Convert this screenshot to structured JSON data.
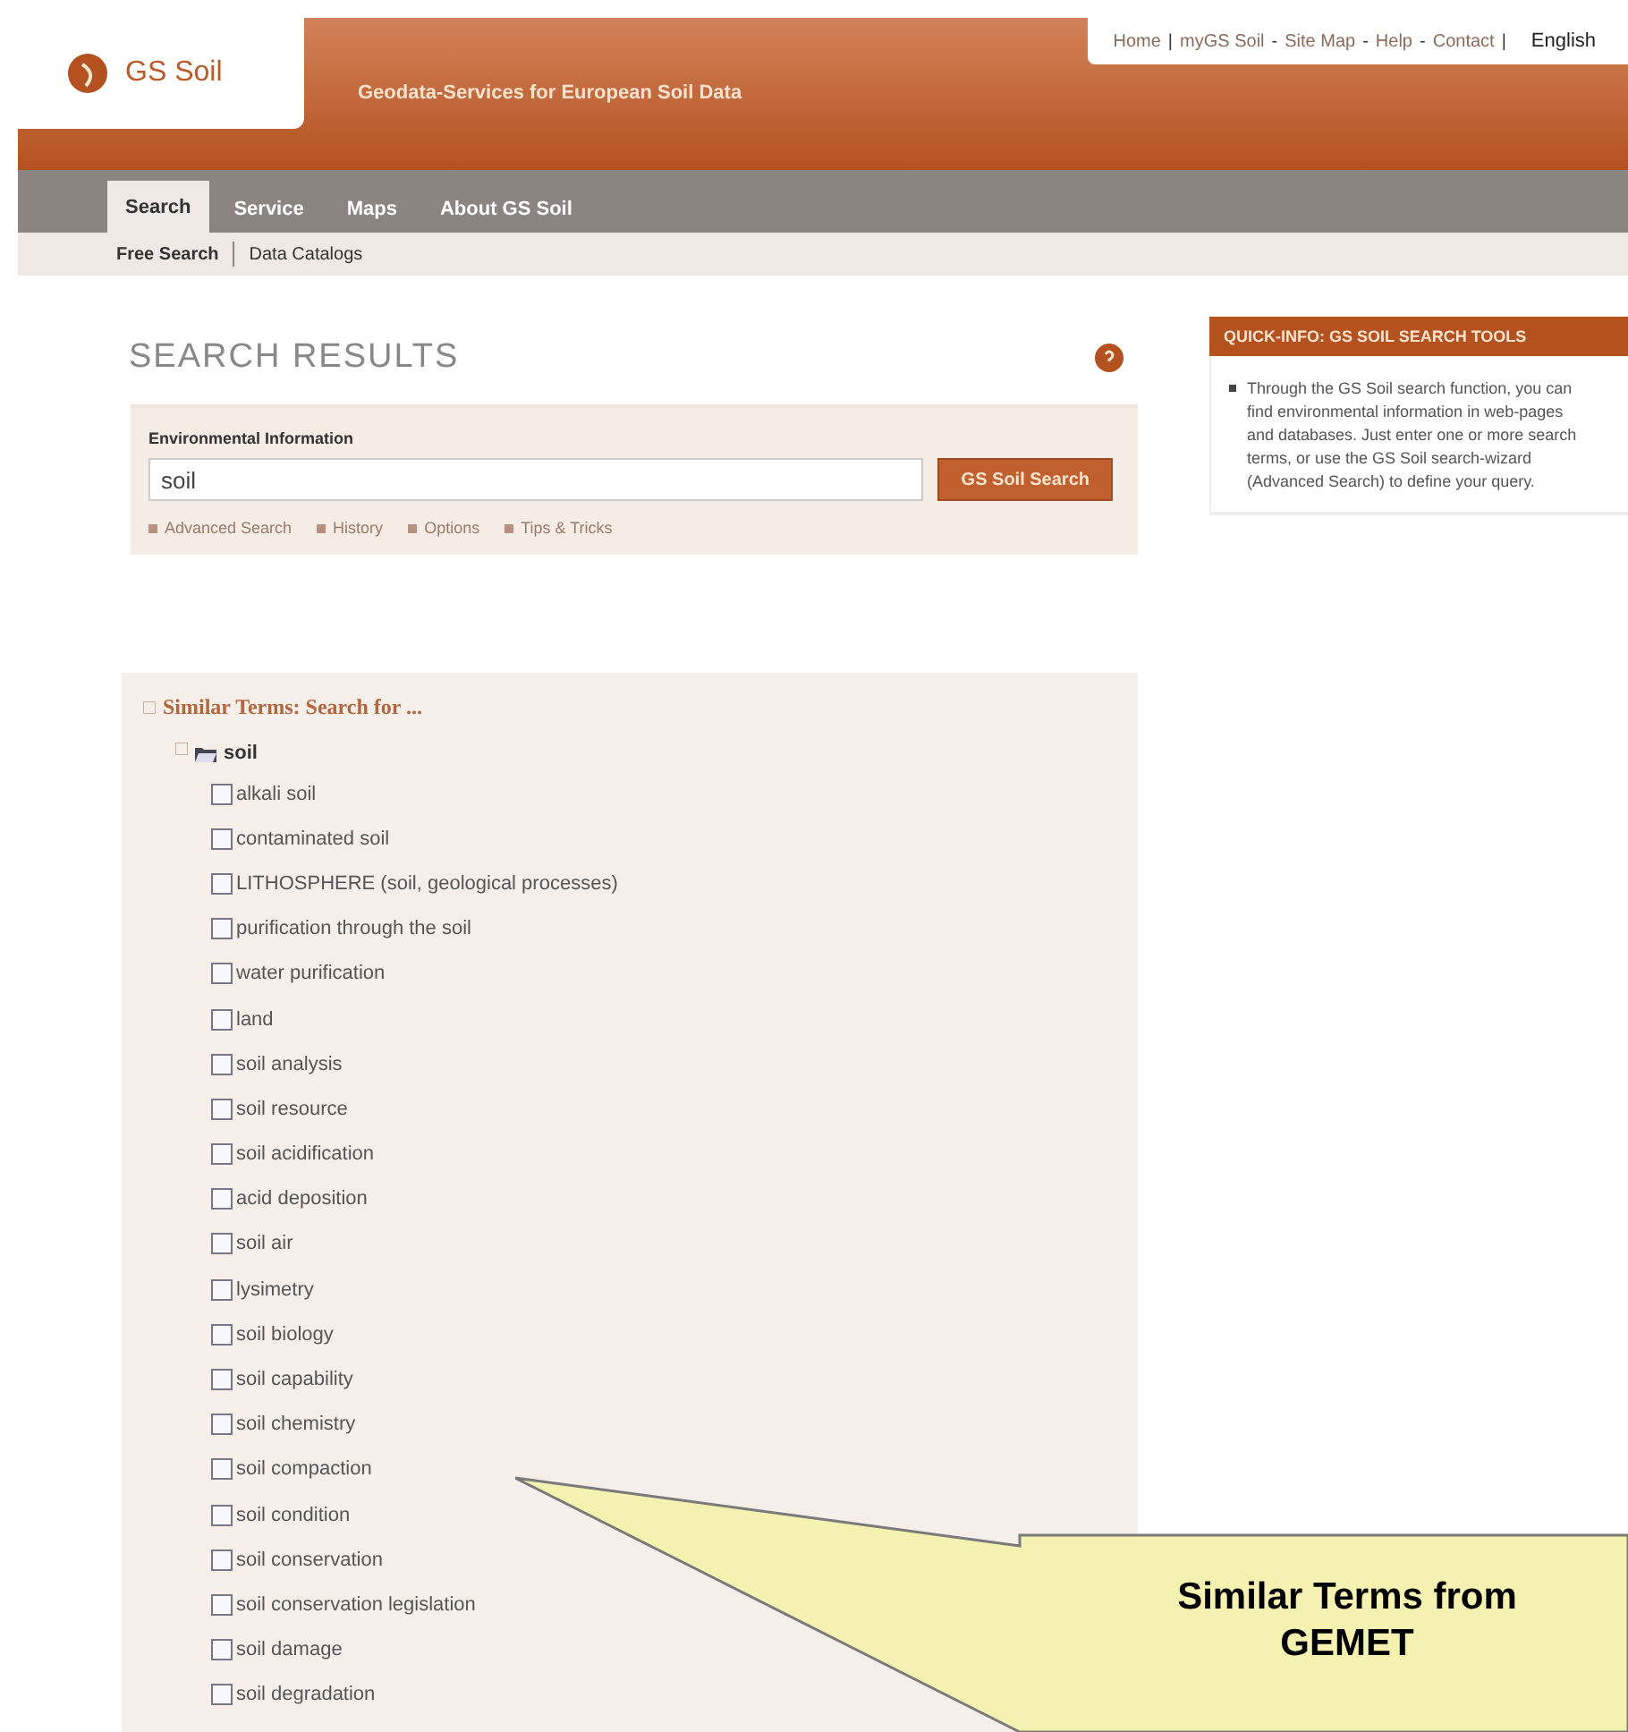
{
  "header": {
    "logo": "GS Soil",
    "tagline": "Geodata-Services for European Soil Data",
    "top_links": [
      {
        "kind": "link",
        "text": "Home"
      },
      {
        "kind": "separator",
        "text": "|"
      },
      {
        "kind": "link",
        "text": "myGS Soil"
      },
      {
        "kind": "separator",
        "text": "-"
      },
      {
        "kind": "link",
        "text": "Site Map"
      },
      {
        "kind": "separator",
        "text": "-"
      },
      {
        "kind": "link",
        "text": "Help"
      },
      {
        "kind": "separator",
        "text": "-"
      },
      {
        "kind": "link",
        "text": "Contact"
      },
      {
        "kind": "separator",
        "text": "|"
      }
    ],
    "language": "English"
  },
  "tabs": [
    {
      "label": "Search",
      "selected": true
    },
    {
      "label": "Service",
      "selected": false
    },
    {
      "label": "Maps",
      "selected": false
    },
    {
      "label": "About GS Soil",
      "selected": false
    }
  ],
  "subnav": [
    {
      "label": "Free Search",
      "selected": true
    },
    {
      "label": "Data Catalogs",
      "selected": false
    }
  ],
  "page_title": "SEARCH RESULTS",
  "search": {
    "label": "Environmental Information",
    "value": "soil",
    "button": "GS Soil Search",
    "links": [
      "Advanced Search",
      "History",
      "Options",
      "Tips & Tricks"
    ]
  },
  "similar_terms": {
    "title": "Similar Terms: Search for ...",
    "root": {
      "label": "soil",
      "expanded": true,
      "children": [
        {
          "label": "alkali soil",
          "checked": false
        },
        {
          "label": "contaminated soil",
          "checked": false
        },
        {
          "label": "LITHOSPHERE (soil, geological processes)",
          "checked": false
        },
        {
          "label": "purification through the soil",
          "checked": false
        },
        {
          "label": "water purification",
          "checked": false
        },
        {
          "label": "land",
          "checked": false
        },
        {
          "label": "soil analysis",
          "checked": false
        },
        {
          "label": "soil resource",
          "checked": false
        },
        {
          "label": "soil acidification",
          "checked": false
        },
        {
          "label": "acid deposition",
          "checked": false
        },
        {
          "label": "soil air",
          "checked": false
        },
        {
          "label": "lysimetry",
          "checked": false
        },
        {
          "label": "soil biology",
          "checked": false
        },
        {
          "label": "soil capability",
          "checked": false
        },
        {
          "label": "soil chemistry",
          "checked": false
        },
        {
          "label": "soil compaction",
          "checked": false
        },
        {
          "label": "soil condition",
          "checked": false
        },
        {
          "label": "soil conservation",
          "checked": false
        },
        {
          "label": "soil conservation legislation",
          "checked": false
        },
        {
          "label": "soil damage",
          "checked": false
        },
        {
          "label": "soil degradation",
          "checked": false
        }
      ]
    }
  },
  "quick_info": {
    "title": "QUICK-INFO: GS SOIL SEARCH TOOLS",
    "text": "Through the GS Soil search function, you can find environmental information in web-pages and databases. Just enter one or more search terms, or use the GS Soil search-wizard (Advanced Search) to define your query."
  },
  "callout": {
    "text": "Similar Terms from GEMET"
  }
}
